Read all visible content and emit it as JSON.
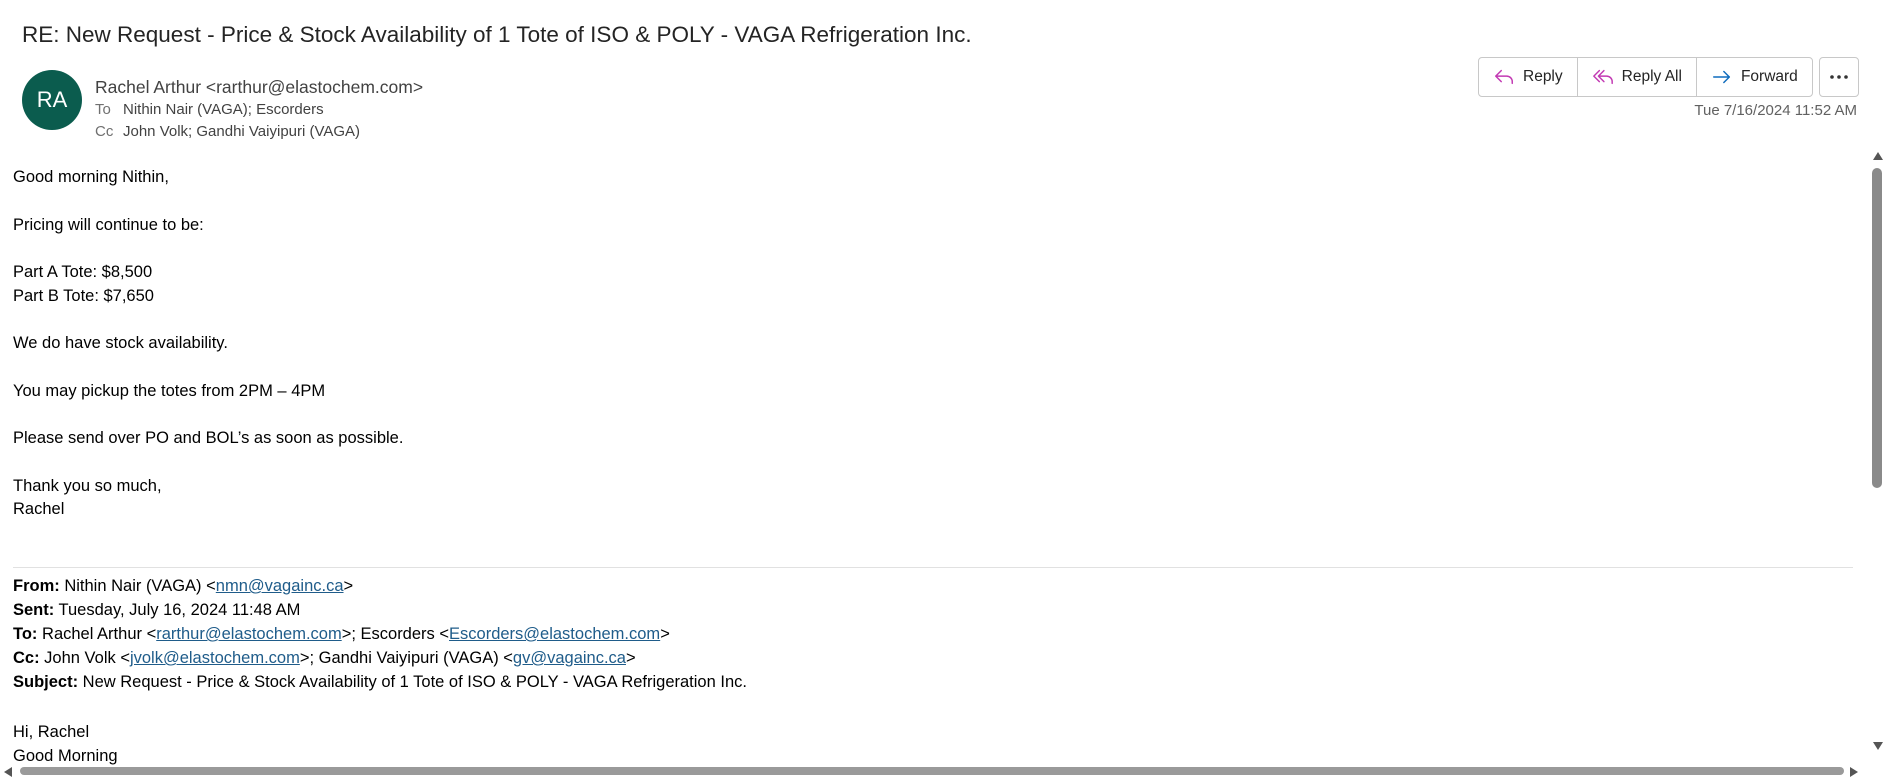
{
  "message": {
    "subject": "RE: New Request - Price & Stock Availability of 1 Tote of ISO & POLY - VAGA Refrigeration Inc.",
    "avatar_initials": "RA",
    "avatar_color": "#0b5c4e",
    "sender": "Rachel Arthur <rarthur@elastochem.com>",
    "to_label": "To",
    "to": "Nithin Nair (VAGA); Escorders",
    "cc_label": "Cc",
    "cc": "John Volk; Gandhi Vaiyipuri (VAGA)",
    "date": "Tue 7/16/2024 11:52 AM"
  },
  "actions": {
    "reply": "Reply",
    "reply_all": "Reply All",
    "forward": "Forward",
    "more_icon": "more-horizontal-icon"
  },
  "body": {
    "greeting": "Good morning Nithin,",
    "line1": "Pricing will continue to be:",
    "part_a": "Part A Tote: $8,500",
    "part_b": "Part B Tote: $7,650",
    "stock": "We do have stock availability.",
    "pickup": "You may pickup the totes from 2PM – 4PM",
    "send": "Please send over PO and BOL’s as soon as possible.",
    "thanks": "Thank you so much,",
    "signature": "Rachel"
  },
  "quoted": {
    "from_label": "From:",
    "from_name": " Nithin Nair (VAGA) <",
    "from_email": "nmn@vagainc.ca",
    "sent_label": "Sent:",
    "sent": " Tuesday, July 16, 2024 11:48 AM",
    "to_label": "To:",
    "to_name1": " Rachel Arthur <",
    "to_email1": "rarthur@elastochem.com",
    "to_name2": ">; Escorders <",
    "to_email2": "Escorders@elastochem.com",
    "cc_label": "Cc:",
    "cc_name1": " John Volk <",
    "cc_email1": "jvolk@elastochem.com",
    "cc_name2": ">; Gandhi Vaiyipuri (VAGA) <",
    "cc_email2": "gv@vagainc.ca",
    "subject_label": "Subject:",
    "subject": " New Request - Price & Stock Availability of 1 Tote of ISO & POLY - VAGA Refrigeration Inc.",
    "greet1": "Hi, Rachel",
    "greet2": "Good Morning"
  },
  "colors": {
    "reply_icon": "#c239b3",
    "forward_icon": "#0f6cbd",
    "link": "#1f5c8a"
  }
}
